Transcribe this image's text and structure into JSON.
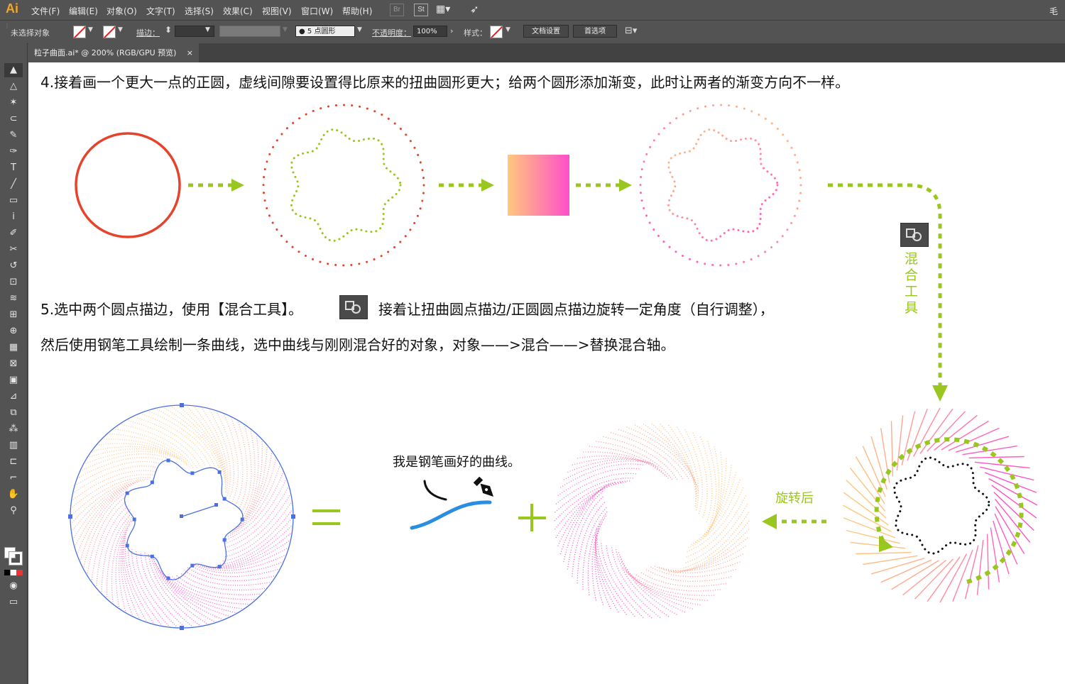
{
  "app": {
    "logo": "Ai",
    "menus": [
      "文件(F)",
      "编辑(E)",
      "对象(O)",
      "文字(T)",
      "选择(S)",
      "效果(C)",
      "视图(V)",
      "窗口(W)",
      "帮助(H)"
    ],
    "bridge_label": "Br",
    "stock_label": "St",
    "user": "毛"
  },
  "control": {
    "selection_label": "未选择对象",
    "stroke_label": "描边：",
    "brush_value": "5 点圆形",
    "opacity_label": "不透明度：",
    "opacity_value": "100%",
    "style_label": "样式：",
    "doc_setup": "文档设置",
    "preferences": "首选项"
  },
  "tab": {
    "title": "粒子曲面.ai* @ 200% (RGB/GPU 预览)",
    "close": "×"
  },
  "tools": [
    "selection-tool",
    "direct-selection-tool",
    "magic-wand-tool",
    "lasso-tool",
    "pen-tool",
    "curvature-tool",
    "type-tool",
    "line-tool",
    "rectangle-tool",
    "paintbrush-tool",
    "pencil-tool",
    "scissors-tool",
    "rotate-tool",
    "scale-tool",
    "warp-tool",
    "free-transform-tool",
    "shape-builder-tool",
    "perspective-grid-tool",
    "mesh-tool",
    "gradient-tool",
    "eyedropper-tool",
    "blend-tool",
    "symbol-sprayer-tool",
    "graph-tool",
    "artboard-tool",
    "slice-tool",
    "hand-tool",
    "zoom-tool"
  ],
  "tool_glyphs": [
    "▲",
    "△",
    "✶",
    "⊂",
    "✎",
    "✑",
    "T",
    "╱",
    "▭",
    "ⅰ",
    "✐",
    "✂",
    "↺",
    "⊡",
    "≋",
    "⊞",
    "⊕",
    "▦",
    "⊠",
    "▣",
    "⊿",
    "⧉",
    "⁂",
    "▥",
    "⊏",
    "⌐",
    "✋",
    "⚲"
  ],
  "colors": {
    "accent_green": "#9ac620",
    "red_circle": "#e5432b",
    "gradient_start": "#ffc87c",
    "gradient_end": "#ff4fc8",
    "pen_curve": "#2a8de0",
    "selection_blue": "#4b70e2"
  },
  "content": {
    "step4": "4.接着画一个更大一点的正圆，虚线间隙要设置得比原来的扭曲圆形更大；给两个圆形添加渐变，此时让两者的渐变方向不一样。",
    "step5_line1a": "5.选中两个圆点描边，使用【混合工具】。",
    "step5_line1b": "接着让扭曲圆点描边/正圆圆点描边旋转一定角度（自行调整），",
    "step5_line2": "然后使用钢笔工具绘制一条曲线，选中曲线与刚刚混合好的对象，对象——>混合——>替换混合轴。",
    "blend_tool_label": "混合工具",
    "after_rotate_label": "旋转后",
    "pen_curve_label": "我是钢笔画好的曲线。"
  }
}
